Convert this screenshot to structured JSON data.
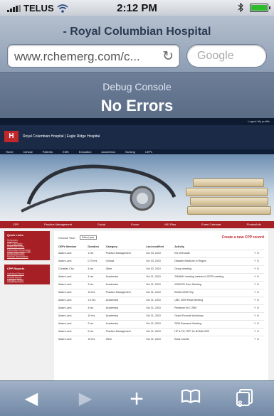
{
  "status_bar": {
    "carrier": "TELUS",
    "time": "2:12 PM",
    "icons": [
      "signal-icon",
      "wifi-icon",
      "bluetooth-icon",
      "battery-icon"
    ]
  },
  "browser": {
    "page_title": "- Royal Columbian Hospital",
    "url": "www.rchemerg.com/c...",
    "search_placeholder": "Google"
  },
  "debug_console": {
    "title": "Debug Console",
    "message": "No Errors"
  },
  "webpage": {
    "site_name": "Royal Columbian Hospital | Eagle Ridge Hospital",
    "top_links": "Logout  My profile",
    "nav": [
      "Home",
      "Clinical",
      "Patients",
      "EMS",
      "Education",
      "Academics",
      "Nursing",
      "CEPs"
    ],
    "red_nav": [
      "CPP",
      "Practice Management",
      "Social",
      "Forum",
      "MD Files",
      "Event Calendar",
      "Photos/Info"
    ],
    "sidebar": {
      "quick_links_title": "Quick Links",
      "quick_links": [
        "Schedules",
        "CPP Calculator",
        "Rules and Forms",
        "Information Technology",
        "Useful Web Sites",
        "Medical Associations"
      ],
      "cpp_reports_title": "CPP Reports",
      "cpp_reports": [
        "Individual Report",
        "Overall Report",
        "Category Report"
      ]
    },
    "choose_year_label": "Choose Year:",
    "year_select": "Select year",
    "create_link": "Create a new CPP record",
    "table": {
      "columns": [
        "CEPs Member",
        "Duration",
        "Category",
        "Last modified",
        "Activity"
      ],
      "rows": [
        [
          "Adam Land",
          "1 hrs",
          "Practice Management",
          "Oct 03, 2010",
          "ED shift audit"
        ],
        [
          "Adam Land",
          "0.75 hrs",
          "Clinical",
          "Oct 03, 2010",
          "Disaster Medicine in Region"
        ],
        [
          "Christian Cho",
          "4 hrs",
          "Other",
          "Oct 02, 2010",
          "Group meeting"
        ],
        [
          "Adam Land",
          "4 hrs",
          "Academics",
          "Oct 31, 2010",
          "SIMWAY meeting instead of CEPS meeting"
        ],
        [
          "Adam Land",
          "3 hrs",
          "Academics",
          "Oct 31, 2010",
          "WSM ED Exec Meeting"
        ],
        [
          "Adam Land",
          "10 hrs",
          "Practice Management",
          "Oct 31, 2010",
          "BCMA 2009 Rep"
        ],
        [
          "Adam Land",
          "1.5 hrs",
          "Academics",
          "Oct 31, 2010",
          "UBC 2009 Head Meeting"
        ],
        [
          "Adam Land",
          "4 hrs",
          "Academics",
          "Oct 31, 2010",
          "Reviewer for CJEM"
        ],
        [
          "Adam Land",
          "10 hrs",
          "Academics",
          "Oct 31, 2010",
          "Grand Rounds Workshop"
        ],
        [
          "Adam Land",
          "2 hrs",
          "Academics",
          "Oct 31, 2010",
          "SEM Research Meeting"
        ],
        [
          "Adam Land",
          "5 hrs",
          "Practice Management",
          "Oct 31, 2010",
          "HP & PH, RFP for BCMA 2009"
        ],
        [
          "Adam Land",
          "10 hrs",
          "Other",
          "Oct 31, 2010",
          "Book rounds"
        ]
      ]
    }
  },
  "toolbar": {
    "back": "◀",
    "forward": "▶",
    "add": "+",
    "bookmarks": "📖",
    "pages": "8"
  }
}
